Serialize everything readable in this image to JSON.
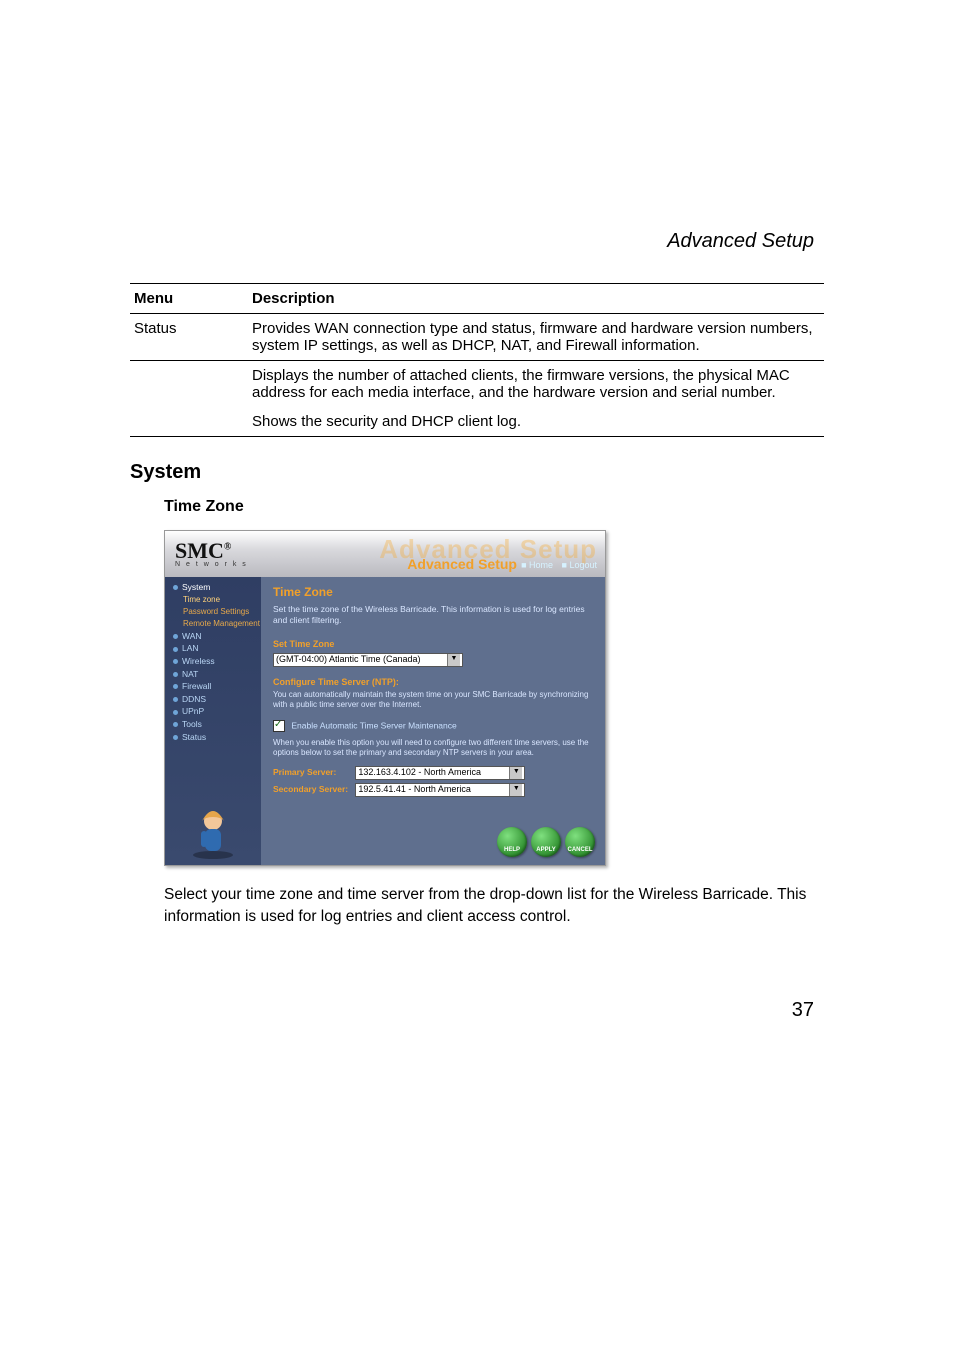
{
  "page_header": "Advanced Setup",
  "page_number": "37",
  "table": {
    "headers": {
      "menu": "Menu",
      "description": "Description"
    },
    "row1": {
      "menu": "Status",
      "p1": "Provides WAN connection type and status, firmware and hardware version numbers, system IP settings, as well as DHCP, NAT, and Firewall information.",
      "p2": "Displays the number of attached clients, the firmware versions, the physical MAC address for each media interface, and the hardware version and serial number.",
      "p3": "Shows the security and DHCP client log."
    }
  },
  "headings": {
    "system": "System",
    "timezone": "Time Zone"
  },
  "screenshot": {
    "logo_main": "SMC",
    "logo_reg": "®",
    "logo_sub": "N e t w o r k s",
    "banner_ghost": "Advanced Setup",
    "banner_adv": "Advanced Setup",
    "link_home": "■ Home",
    "link_logout": "■ Logout",
    "sidebar": {
      "system": "System",
      "tz": "Time zone",
      "pw": "Password Settings",
      "rm": "Remote Management",
      "wan": "WAN",
      "lan": "LAN",
      "wireless": "Wireless",
      "nat": "NAT",
      "firewall": "Firewall",
      "ddns": "DDNS",
      "upnp": "UPnP",
      "tools": "Tools",
      "status": "Status"
    },
    "content": {
      "title": "Time Zone",
      "note": "Set the time zone of the Wireless Barricade. This information is used for log entries and client filtering.",
      "set_label": "Set Time Zone",
      "tz_value": "(GMT-04:00) Atlantic Time (Canada)",
      "ntp_head": "Configure Time Server (NTP):",
      "ntp_note": "You can automatically maintain the system time on your SMC Barricade by synchronizing with a public time server over the Internet.",
      "check_label": "Enable Automatic Time Server Maintenance",
      "cfg_note": "When you enable this option you will need to configure two different time servers, use the options below to set the primary and secondary NTP servers in your area.",
      "primary_label": "Primary Server:",
      "primary_value": "132.163.4.102 - North America",
      "secondary_label": "Secondary Server:",
      "secondary_value": "192.5.41.41 - North America",
      "btn_help": "HELP",
      "btn_apply": "APPLY",
      "btn_cancel": "CANCEL"
    }
  },
  "body_text": "Select your time zone and time server from the drop-down list for the Wireless Barricade. This information is used for log entries and client access control."
}
